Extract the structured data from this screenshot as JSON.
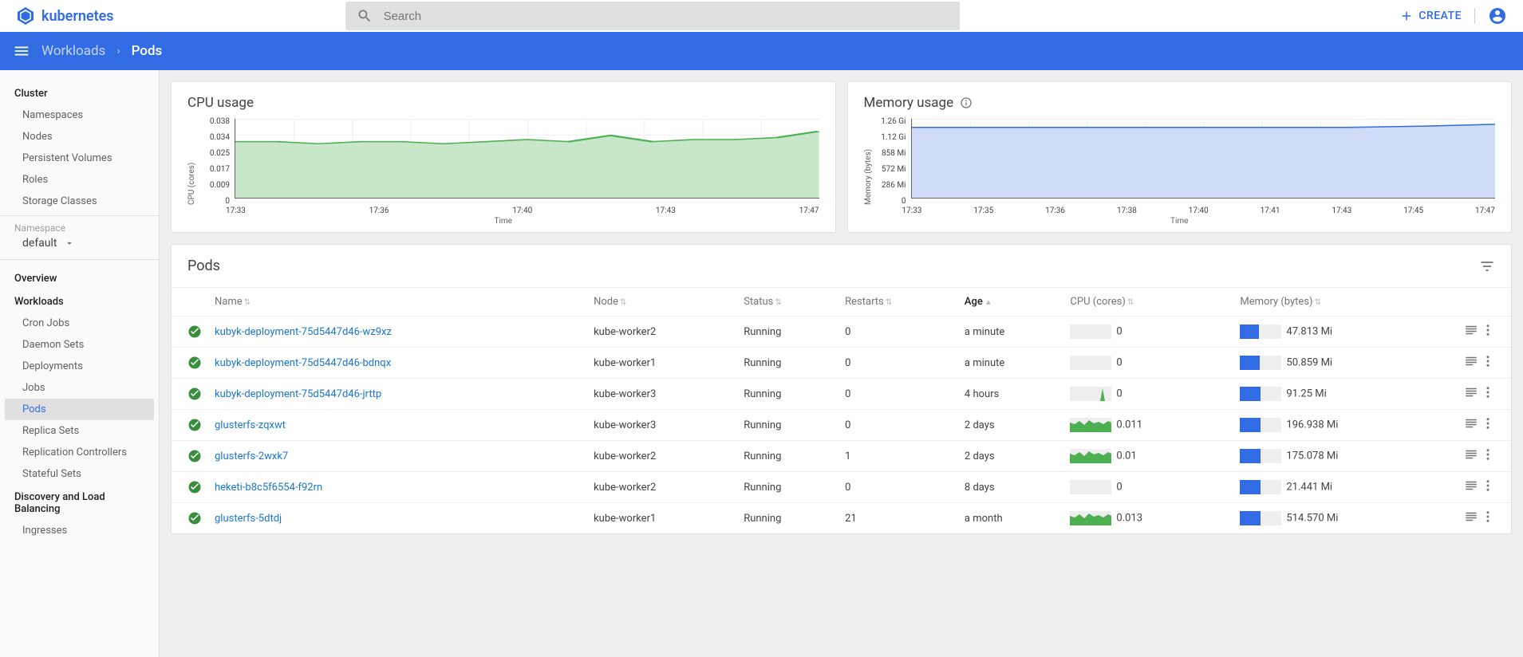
{
  "header": {
    "brand": "kubernetes",
    "search_placeholder": "Search",
    "create_label": "CREATE"
  },
  "breadcrumb": {
    "parent": "Workloads",
    "current": "Pods"
  },
  "sidebar": {
    "cluster_title": "Cluster",
    "cluster_items": [
      "Namespaces",
      "Nodes",
      "Persistent Volumes",
      "Roles",
      "Storage Classes"
    ],
    "ns_label": "Namespace",
    "ns_value": "default",
    "overview": "Overview",
    "workloads_title": "Workloads",
    "workloads_items": [
      "Cron Jobs",
      "Daemon Sets",
      "Deployments",
      "Jobs",
      "Pods",
      "Replica Sets",
      "Replication Controllers",
      "Stateful Sets"
    ],
    "discovery_title": "Discovery and Load Balancing",
    "discovery_items": [
      "Ingresses"
    ]
  },
  "chart_data": [
    {
      "type": "area",
      "title": "CPU usage",
      "xlabel": "Time",
      "ylabel": "CPU (cores)",
      "ylim": [
        0,
        0.038
      ],
      "y_ticks": [
        "0.038",
        "0.034",
        "0.025",
        "0.017",
        "0.009",
        "0"
      ],
      "x_ticks": [
        "17:33",
        "17:36",
        "17:40",
        "17:43",
        "17:47"
      ],
      "x": [
        "17:33",
        "17:34",
        "17:35",
        "17:36",
        "17:37",
        "17:38",
        "17:39",
        "17:40",
        "17:41",
        "17:42",
        "17:43",
        "17:44",
        "17:45",
        "17:46",
        "17:47"
      ],
      "values": [
        0.027,
        0.027,
        0.026,
        0.027,
        0.027,
        0.026,
        0.027,
        0.028,
        0.027,
        0.03,
        0.027,
        0.028,
        0.028,
        0.029,
        0.032
      ],
      "color": "#4caf50",
      "fill": "#c8e6c9"
    },
    {
      "type": "area",
      "title": "Memory usage",
      "xlabel": "Time",
      "ylabel": "Memory (bytes)",
      "ylim": [
        0,
        1290
      ],
      "y_ticks": [
        "1.26 Gi",
        "1.12 Gi",
        "858 Mi",
        "572 Mi",
        "286 Mi",
        "0"
      ],
      "x_ticks": [
        "17:33",
        "17:35",
        "17:36",
        "17:38",
        "17:40",
        "17:41",
        "17:43",
        "17:45",
        "17:47"
      ],
      "x": [
        "17:33",
        "17:35",
        "17:36",
        "17:38",
        "17:40",
        "17:41",
        "17:43",
        "17:45",
        "17:47"
      ],
      "values": [
        1150,
        1150,
        1150,
        1150,
        1150,
        1150,
        1150,
        1170,
        1200
      ],
      "color": "#326ce5",
      "fill": "#d0dbf7"
    }
  ],
  "table": {
    "title": "Pods",
    "columns": [
      "Name",
      "Node",
      "Status",
      "Restarts",
      "Age",
      "CPU (cores)",
      "Memory (bytes)"
    ],
    "sorted_column": "Age",
    "rows": [
      {
        "name": "kubyk-deployment-75d5447d46-wz9xz",
        "node": "kube-worker2",
        "status": "Running",
        "restarts": "0",
        "age": "a minute",
        "cpu": "0",
        "cpu_spark": "flat",
        "mem": "47.813 Mi",
        "mem_pct": 45
      },
      {
        "name": "kubyk-deployment-75d5447d46-bdnqx",
        "node": "kube-worker1",
        "status": "Running",
        "restarts": "0",
        "age": "a minute",
        "cpu": "0",
        "cpu_spark": "flat",
        "mem": "50.859 Mi",
        "mem_pct": 47
      },
      {
        "name": "kubyk-deployment-75d5447d46-jrttp",
        "node": "kube-worker3",
        "status": "Running",
        "restarts": "0",
        "age": "4 hours",
        "cpu": "0",
        "cpu_spark": "spike",
        "mem": "91.25 Mi",
        "mem_pct": 50
      },
      {
        "name": "glusterfs-zqxwt",
        "node": "kube-worker3",
        "status": "Running",
        "restarts": "0",
        "age": "2 days",
        "cpu": "0.011",
        "cpu_spark": "wave",
        "mem": "196.938 Mi",
        "mem_pct": 50
      },
      {
        "name": "glusterfs-2wxk7",
        "node": "kube-worker2",
        "status": "Running",
        "restarts": "1",
        "age": "2 days",
        "cpu": "0.01",
        "cpu_spark": "wave",
        "mem": "175.078 Mi",
        "mem_pct": 50
      },
      {
        "name": "heketi-b8c5f6554-f92rn",
        "node": "kube-worker2",
        "status": "Running",
        "restarts": "0",
        "age": "8 days",
        "cpu": "0",
        "cpu_spark": "flat",
        "mem": "21.441 Mi",
        "mem_pct": 50
      },
      {
        "name": "glusterfs-5dtdj",
        "node": "kube-worker1",
        "status": "Running",
        "restarts": "21",
        "age": "a month",
        "cpu": "0.013",
        "cpu_spark": "wave",
        "mem": "514.570 Mi",
        "mem_pct": 50
      }
    ]
  }
}
